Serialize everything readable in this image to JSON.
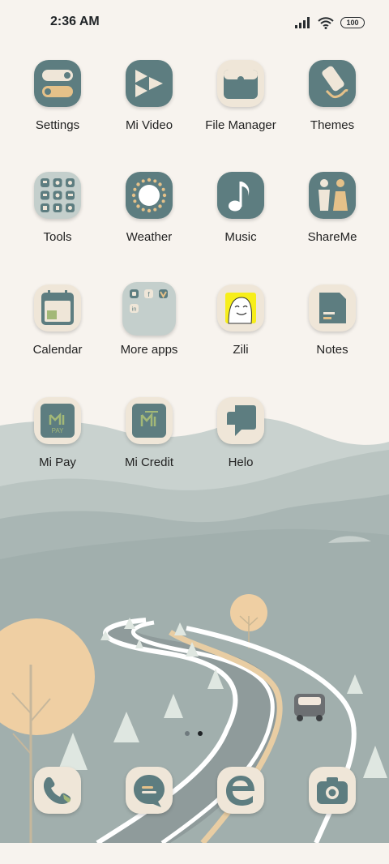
{
  "status_bar": {
    "time": "2:36 AM",
    "battery": "100"
  },
  "apps": [
    {
      "label": "Settings"
    },
    {
      "label": "Mi Video"
    },
    {
      "label": "File Manager"
    },
    {
      "label": "Themes"
    },
    {
      "label": "Tools"
    },
    {
      "label": "Weather"
    },
    {
      "label": "Music"
    },
    {
      "label": "ShareMe"
    },
    {
      "label": "Calendar"
    },
    {
      "label": "More apps"
    },
    {
      "label": "Zili"
    },
    {
      "label": "Notes"
    },
    {
      "label": "Mi Pay"
    },
    {
      "label": "Mi Credit"
    },
    {
      "label": "Helo"
    }
  ],
  "page_indicator": {
    "pages": 2,
    "active": 2
  },
  "dock": [
    "phone-icon",
    "messages-icon",
    "browser-icon",
    "camera-icon"
  ],
  "colors": {
    "teal": "#5d7d80",
    "cream": "#efe6d8",
    "sand": "#e5c189",
    "background": "#f7f3ee"
  }
}
